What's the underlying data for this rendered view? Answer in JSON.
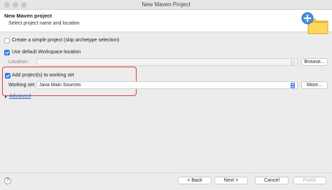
{
  "window": {
    "title": "New Maven Project"
  },
  "header": {
    "title": "New Maven project",
    "subtitle": "Select project name and location"
  },
  "form": {
    "simple_project_label": "Create a simple project (skip archetype selection)",
    "simple_project_checked": false,
    "default_workspace_label": "Use default Workspace location",
    "default_workspace_checked": true,
    "location_label": "Location:",
    "location_value": "",
    "browse_label": "Browse...",
    "working_set_checkbox_label": "Add project(s) to working set",
    "working_set_checked": true,
    "working_set_label": "Working set:",
    "working_set_value": "Java Main Sources",
    "more_label": "More...",
    "advanced_label": "Advanced"
  },
  "footer": {
    "help_label": "?",
    "back_label": "< Back",
    "next_label": "Next >",
    "cancel_label": "Cancel",
    "finish_label": "Finish"
  },
  "colors": {
    "accent": "#3b82f6",
    "highlight": "#e23a3a",
    "link": "#2a6acb"
  }
}
